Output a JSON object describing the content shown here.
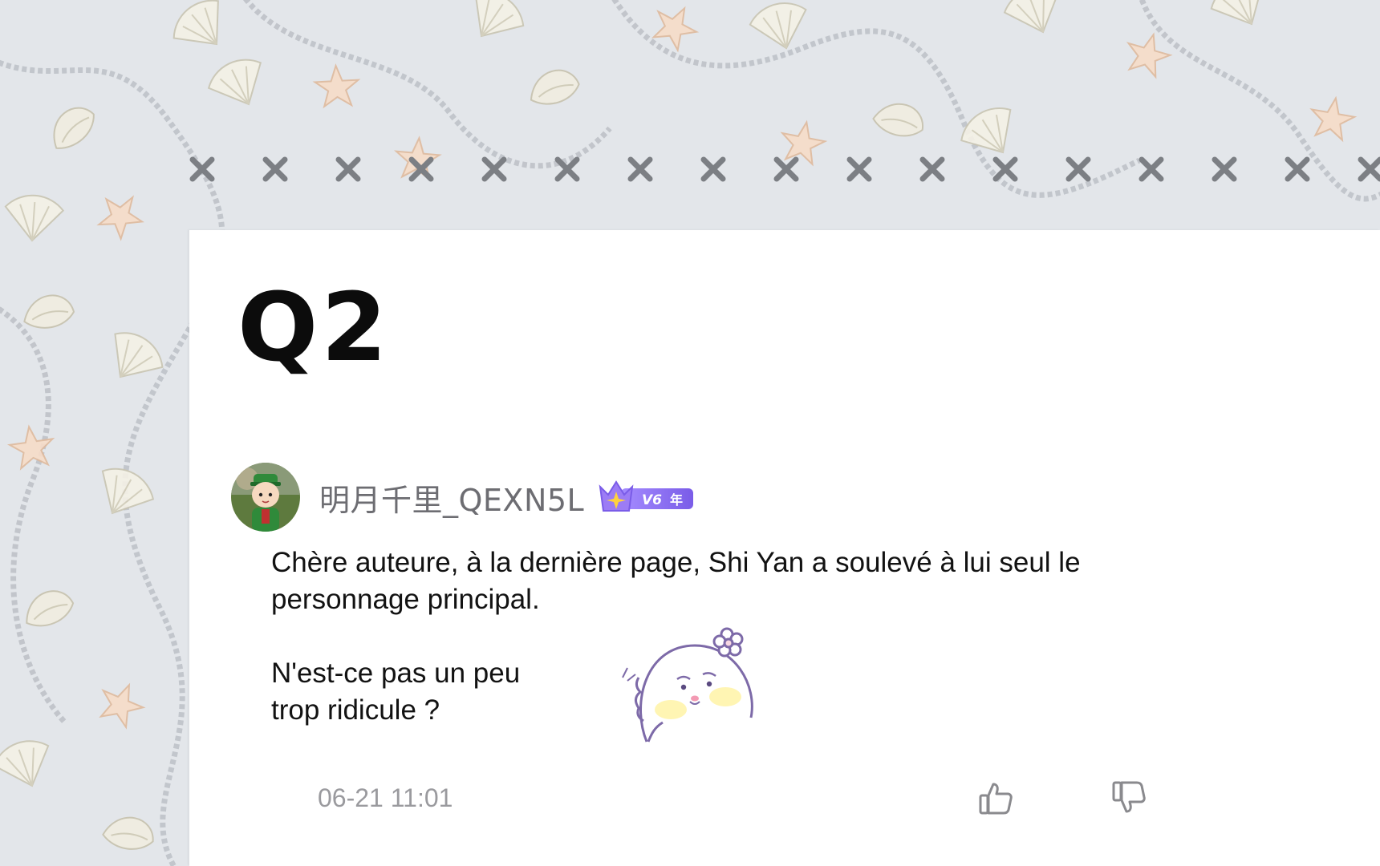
{
  "question": {
    "label": "Q2"
  },
  "comment": {
    "username": "明月千里_QEXN5L",
    "badge": {
      "level": "V6",
      "suffix": "年"
    },
    "paragraphs": [
      "Chère auteure, à la dernière page, Shi Yan a soulevé à lui seul le personnage principal.",
      "N'est-ce pas un peu",
      "trop ridicule ?"
    ],
    "timestamp": "06-21 11:01",
    "actions": {
      "like_icon": "thumbs-up-icon",
      "dislike_icon": "thumbs-down-icon"
    }
  },
  "colors": {
    "background": "#e3e6ea",
    "card": "#ffffff",
    "stitch": "#7c7f84",
    "username": "#6d6d72",
    "timestamp": "#9a9a9e",
    "badge_purple": "#8a6cf0"
  }
}
